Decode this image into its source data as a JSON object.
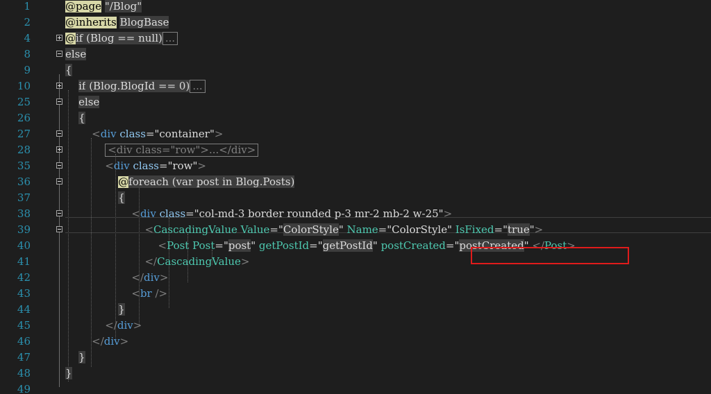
{
  "editor": {
    "lines": [
      {
        "num": "1",
        "fold": "",
        "tokens": [
          {
            "text": "@page",
            "cls": "rz-at"
          },
          {
            "text": " "
          },
          {
            "text": "\"/Blog\"",
            "cls": "s razor"
          }
        ]
      },
      {
        "num": "2",
        "fold": "",
        "tokens": [
          {
            "text": "@inherits",
            "cls": "rz-at"
          },
          {
            "text": " "
          },
          {
            "text": "BlogBase",
            "cls": "t razor"
          }
        ]
      },
      {
        "num": "4",
        "fold": "plus",
        "tokens": [
          {
            "text": "@",
            "cls": "rz-at"
          },
          {
            "text": "if (Blog == ",
            "cls": "razor"
          },
          {
            "text": "null",
            "cls": "k razor"
          },
          {
            "text": ")",
            "cls": "razor"
          },
          {
            "text": "...",
            "cls": "collapsed"
          }
        ]
      },
      {
        "num": "8",
        "fold": "minus",
        "tokens": [
          {
            "text": "else",
            "cls": "kw razor"
          }
        ]
      },
      {
        "num": "9",
        "fold": "",
        "tokens": [
          {
            "text": "{",
            "cls": "razor"
          }
        ]
      },
      {
        "num": "10",
        "fold": "plus",
        "tokens": [
          {
            "text": "    "
          },
          {
            "text": "if",
            "cls": "kw razor"
          },
          {
            "text": " (Blog.BlogId == 0)",
            "cls": "razor"
          },
          {
            "text": "...",
            "cls": "collapsed"
          }
        ]
      },
      {
        "num": "25",
        "fold": "minus",
        "tokens": [
          {
            "text": "    "
          },
          {
            "text": "else",
            "cls": "kw razor"
          }
        ]
      },
      {
        "num": "26",
        "fold": "",
        "tokens": [
          {
            "text": "    "
          },
          {
            "text": "{",
            "cls": "razor"
          }
        ]
      },
      {
        "num": "27",
        "fold": "minus",
        "tokens": [
          {
            "text": "        "
          },
          {
            "text": "<",
            "cls": "p"
          },
          {
            "text": "div",
            "cls": "ts"
          },
          {
            "text": " "
          },
          {
            "text": "class",
            "cls": "attr"
          },
          {
            "text": "=\"container\"",
            "cls": ""
          },
          {
            "text": ">",
            "cls": "p"
          }
        ]
      },
      {
        "num": "28",
        "fold": "plus",
        "tokens": [
          {
            "text": "            "
          },
          {
            "text": "<div class=\"row\">...</div>",
            "cls": "collapsed"
          }
        ]
      },
      {
        "num": "35",
        "fold": "minus",
        "tokens": [
          {
            "text": "            "
          },
          {
            "text": "<",
            "cls": "p"
          },
          {
            "text": "div",
            "cls": "ts"
          },
          {
            "text": " "
          },
          {
            "text": "class",
            "cls": "attr"
          },
          {
            "text": "=\"row\"",
            "cls": ""
          },
          {
            "text": ">",
            "cls": "p"
          }
        ]
      },
      {
        "num": "36",
        "fold": "minus",
        "tokens": [
          {
            "text": "                "
          },
          {
            "text": "@",
            "cls": "rz-at"
          },
          {
            "text": "foreach",
            "cls": "kw razor"
          },
          {
            "text": " (",
            "cls": "razor"
          },
          {
            "text": "var",
            "cls": "k razor"
          },
          {
            "text": " ",
            "cls": "razor"
          },
          {
            "text": "post",
            "cls": "v razor"
          },
          {
            "text": " ",
            "cls": "razor"
          },
          {
            "text": "in",
            "cls": "k razor"
          },
          {
            "text": " Blog.Posts)",
            "cls": "razor"
          }
        ]
      },
      {
        "num": "37",
        "fold": "",
        "tokens": [
          {
            "text": "                "
          },
          {
            "text": "{",
            "cls": "razor"
          }
        ]
      },
      {
        "num": "38",
        "fold": "minus",
        "tokens": [
          {
            "text": "                    "
          },
          {
            "text": "<",
            "cls": "p"
          },
          {
            "text": "div",
            "cls": "ts"
          },
          {
            "text": " "
          },
          {
            "text": "class",
            "cls": "attr"
          },
          {
            "text": "=\"col-md-3 border rounded p-3 mr-2 mb-2 w-25\"",
            "cls": ""
          },
          {
            "text": ">",
            "cls": "p"
          }
        ]
      },
      {
        "num": "39",
        "fold": "minus",
        "tokens": [
          {
            "text": "                        "
          },
          {
            "text": "<",
            "cls": "p"
          },
          {
            "text": "CascadingValue",
            "cls": "t"
          },
          {
            "text": " "
          },
          {
            "text": "Value",
            "cls": "attrg"
          },
          {
            "text": "=\"",
            "cls": ""
          },
          {
            "text": "ColorStyle",
            "cls": "razor"
          },
          {
            "text": "\" ",
            "cls": ""
          },
          {
            "text": "Name",
            "cls": "attrg"
          },
          {
            "text": "=\"ColorStyle\" ",
            "cls": ""
          },
          {
            "text": "IsFixed",
            "cls": "attrg"
          },
          {
            "text": "=\"",
            "cls": ""
          },
          {
            "text": "true",
            "cls": "k razor"
          },
          {
            "text": "\"",
            "cls": ""
          },
          {
            "text": ">",
            "cls": "p"
          }
        ]
      },
      {
        "num": "40",
        "fold": "",
        "tokens": [
          {
            "text": "                            "
          },
          {
            "text": "<",
            "cls": "p"
          },
          {
            "text": "Post",
            "cls": "t"
          },
          {
            "text": " "
          },
          {
            "text": "Post",
            "cls": "attrg"
          },
          {
            "text": "=\"",
            "cls": ""
          },
          {
            "text": "post",
            "cls": "v razor"
          },
          {
            "text": "\" ",
            "cls": ""
          },
          {
            "text": "getPostId",
            "cls": "attrg"
          },
          {
            "text": "=\"",
            "cls": ""
          },
          {
            "text": "getPostId",
            "cls": "razor"
          },
          {
            "text": "\" ",
            "cls": ""
          },
          {
            "text": "postCreated",
            "cls": "attrg"
          },
          {
            "text": "=\"",
            "cls": ""
          },
          {
            "text": "postCreated",
            "cls": "razor"
          },
          {
            "text": "\" ",
            "cls": ""
          },
          {
            "text": "</",
            "cls": "p"
          },
          {
            "text": "Post",
            "cls": "t"
          },
          {
            "text": ">",
            "cls": "p"
          }
        ]
      },
      {
        "num": "41",
        "fold": "",
        "tokens": [
          {
            "text": "                        "
          },
          {
            "text": "</",
            "cls": "p"
          },
          {
            "text": "CascadingValue",
            "cls": "t"
          },
          {
            "text": ">",
            "cls": "p"
          }
        ]
      },
      {
        "num": "42",
        "fold": "",
        "tokens": [
          {
            "text": "                    "
          },
          {
            "text": "</",
            "cls": "p"
          },
          {
            "text": "div",
            "cls": "ts"
          },
          {
            "text": ">",
            "cls": "p"
          }
        ]
      },
      {
        "num": "43",
        "fold": "",
        "tokens": [
          {
            "text": "                    "
          },
          {
            "text": "<",
            "cls": "p"
          },
          {
            "text": "br",
            "cls": "ts"
          },
          {
            "text": " />",
            "cls": "p"
          }
        ]
      },
      {
        "num": "44",
        "fold": "",
        "tokens": [
          {
            "text": "                "
          },
          {
            "text": "}",
            "cls": "razor"
          }
        ]
      },
      {
        "num": "45",
        "fold": "",
        "tokens": [
          {
            "text": "            "
          },
          {
            "text": "</",
            "cls": "p"
          },
          {
            "text": "div",
            "cls": "ts"
          },
          {
            "text": ">",
            "cls": "p"
          }
        ]
      },
      {
        "num": "46",
        "fold": "",
        "tokens": [
          {
            "text": "        "
          },
          {
            "text": "</",
            "cls": "p"
          },
          {
            "text": "div",
            "cls": "ts"
          },
          {
            "text": ">",
            "cls": "p"
          }
        ]
      },
      {
        "num": "47",
        "fold": "",
        "tokens": [
          {
            "text": "    "
          },
          {
            "text": "}",
            "cls": "razor"
          }
        ]
      },
      {
        "num": "48",
        "fold": "",
        "tokens": [
          {
            "text": "}",
            "cls": "razor"
          }
        ]
      },
      {
        "num": "49",
        "fold": "",
        "tokens": []
      }
    ]
  }
}
